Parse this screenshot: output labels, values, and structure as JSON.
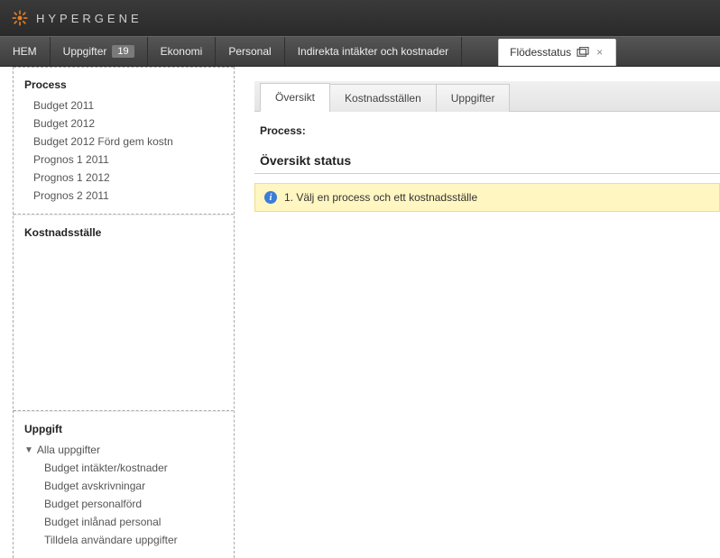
{
  "brand": "HYPERGENE",
  "nav": {
    "items": [
      {
        "label": "HEM"
      },
      {
        "label": "Uppgifter",
        "badge": "19"
      },
      {
        "label": "Ekonomi"
      },
      {
        "label": "Personal"
      },
      {
        "label": "Indirekta intäkter och kostnader"
      }
    ],
    "active_tab": {
      "label": "Flödesstatus",
      "close": "×"
    }
  },
  "sidebar": {
    "process": {
      "title": "Process",
      "items": [
        "Budget 2011",
        "Budget 2012",
        "Budget 2012 Förd gem kostn",
        "Prognos 1 2011",
        "Prognos 1 2012",
        "Prognos 2 2011"
      ]
    },
    "kostnadsstalle": {
      "title": "Kostnadsställe"
    },
    "uppgift": {
      "title": "Uppgift",
      "parent": "Alla uppgifter",
      "children": [
        "Budget intäkter/kostnader",
        "Budget avskrivningar",
        "Budget personalförd",
        "Budget inlånad personal",
        "Tilldela användare uppgifter"
      ]
    }
  },
  "main": {
    "tabs": [
      "Översikt",
      "Kostnadsställen",
      "Uppgifter"
    ],
    "process_label": "Process:",
    "section_title": "Översikt status",
    "info_text": "1. Välj en process och ett kostnadsställe"
  }
}
